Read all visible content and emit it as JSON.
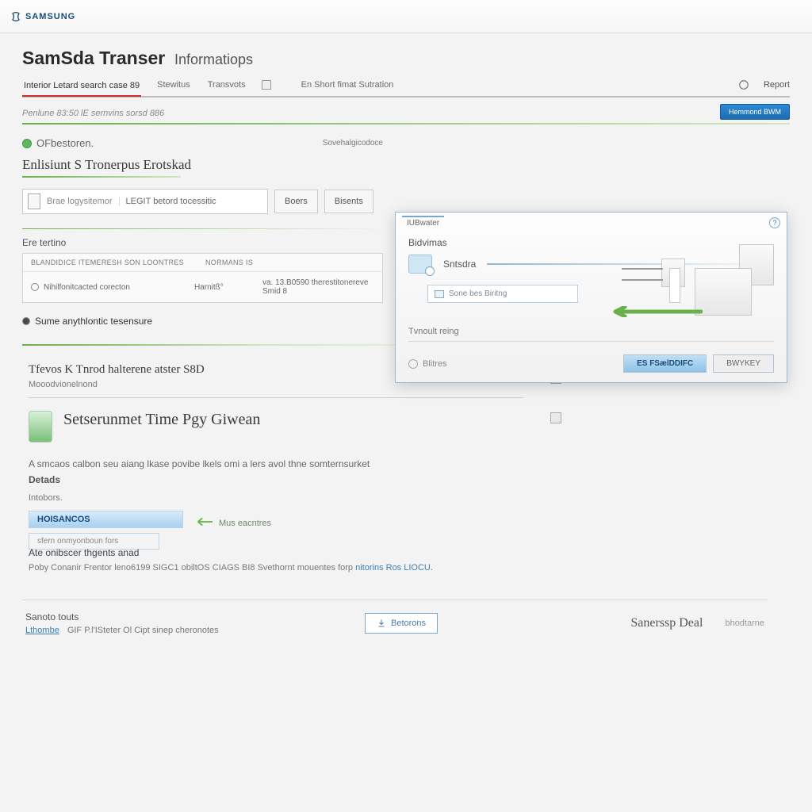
{
  "brand": "SAMSUNG",
  "window_controls": [
    "minimize",
    "maximize",
    "close"
  ],
  "page": {
    "title_main": "SamSda Transer",
    "title_sub": "Informatiops",
    "tabs": [
      "Interior Letard search case 89",
      "Stewitus",
      "Transvots"
    ],
    "tab_extra": "En Short fimat Sutration",
    "help_label": "Report"
  },
  "breadcrumb": "Penlune 83:50 lE sernvins sorsd 886",
  "blue_tag": "Hemmond BWM",
  "step": {
    "label": "OFbestoren.",
    "top_right": "Sovehalgicodoce"
  },
  "main_title": "Enlisiunt S Tronerpus Erotskad",
  "filebox": {
    "placeholder": "Brae logysitemor",
    "embedded_btn": "LEGIT betord tocessitic"
  },
  "buttons": {
    "browse": "Boers",
    "execute": "Bisents"
  },
  "section_label": "Ere tertino",
  "table": {
    "headers": [
      "BLANDIDICE itemeresh son loontres",
      "Normans IS"
    ],
    "row": {
      "c1": "Nihilfonitcacted corecton",
      "c2": "Harnitß°",
      "c3": "va. 13.B0590 therestitonereve Smid 8"
    }
  },
  "radio_label": "Sume anythlontic tesensure",
  "card": {
    "title": "Tfevos K Tnrod halterene atster S8D",
    "subtitle": "Mooodvionelnond",
    "big_heading": "Setserunmet Time Pgy Giwean",
    "para": "A smcaos calbon seu aiang lkase povibe lkels omi a lers avol thne somternsurket",
    "details": "Detads",
    "sublabel": "Intobors.",
    "chip_primary": "HOISANCOS",
    "chip_secondary": "sfern onmyonboun fors",
    "hint": "Mus eacntres",
    "sub2_title": "Ate onibscer thgents anad",
    "sub2_text_a": "Poby Conanir Frentor leno6199 SIGC1 obiltOS CIAGS BI8 Svethornt mouentes forp",
    "sub2_link": "nitorins Ros LIOCU"
  },
  "footer": {
    "label": "Sanoto touts",
    "link": "Lthombe",
    "desc": "GIF P.l'ISteter Ol Cipt sinep cheronotes",
    "button": "Betorons",
    "brand": "Sanerssp Deal",
    "brand_sub": "bhodtarne"
  },
  "dialog": {
    "tab": "IUBwater",
    "heading": "Bidvimas",
    "source_label": "Sntsdra",
    "field_text": "Sone bes Biritng",
    "sub_heading": "Tvnoult reing",
    "refresh": "Blitres",
    "btn_primary": "ES FSælDDIFC",
    "btn_secondary": "BWYKEY"
  }
}
